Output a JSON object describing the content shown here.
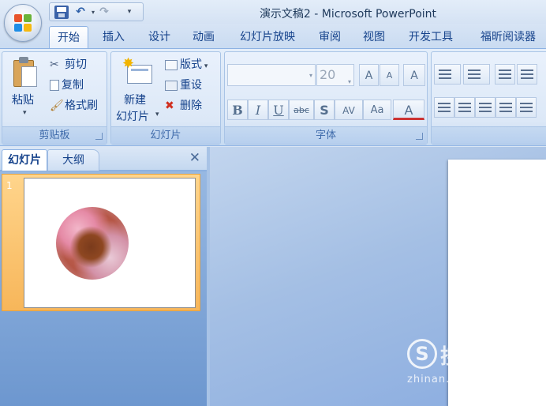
{
  "window": {
    "title": "演示文稿2 - Microsoft PowerPoint"
  },
  "quick_access": {
    "save_icon": "save-icon",
    "undo_icon": "undo-icon",
    "redo_icon": "redo-icon"
  },
  "tabs": [
    {
      "label": "开始",
      "active": true
    },
    {
      "label": "插入"
    },
    {
      "label": "设计"
    },
    {
      "label": "动画"
    },
    {
      "label": "幻灯片放映"
    },
    {
      "label": "审阅"
    },
    {
      "label": "视图"
    },
    {
      "label": "开发工具"
    },
    {
      "label": "福昕阅读器"
    }
  ],
  "ribbon": {
    "clipboard": {
      "label": "剪贴板",
      "paste": "粘贴",
      "cut": "剪切",
      "copy": "复制",
      "format_painter": "格式刷"
    },
    "slides": {
      "label": "幻灯片",
      "new_slide_line1": "新建",
      "new_slide_line2": "幻灯片",
      "layout": "版式",
      "reset": "重设",
      "delete": "删除"
    },
    "font": {
      "label": "字体",
      "font_name": "",
      "font_size": "20",
      "grow": "A",
      "shrink": "A",
      "clear": "A",
      "bold": "B",
      "italic": "I",
      "underline": "U",
      "strike": "abc",
      "shadow": "S",
      "spacing": "AV",
      "case": "Aa",
      "color": "A"
    }
  },
  "left_panel": {
    "tab_slides": "幻灯片",
    "tab_outline": "大纲",
    "thumbnails": [
      {
        "number": "1"
      }
    ]
  },
  "watermark": {
    "brand": "搜狗指南",
    "url": "zhinan.sogou.com"
  }
}
